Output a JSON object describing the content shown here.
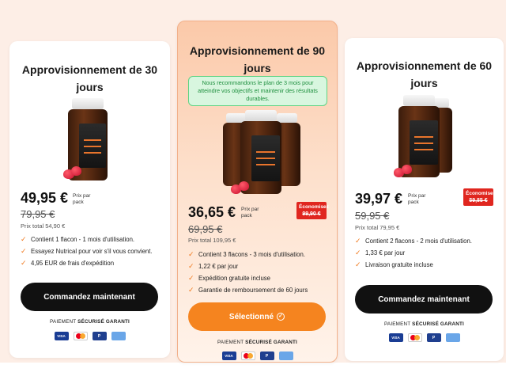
{
  "plans": [
    {
      "title": "Approvisionnement de 30 jours",
      "price": "49,95 €",
      "price_note": "Prix par pack",
      "old_price": "79,95 €",
      "total": "Prix total 54,90 €",
      "features": [
        "Contient 1 flacon - 1 mois d'utilisation.",
        "Essayez Nutrical pour voir s'il vous convient.",
        "4,95 EUR de frais d'expédition"
      ],
      "button": "Commandez maintenant"
    },
    {
      "title": "Approvisionnement de 90 jours",
      "recommendation": "Nous recommandons le plan de 3 mois pour atteindre vos objectifs et maintenir des résultats durables.",
      "price": "36,65 €",
      "price_note": "Prix par pack",
      "old_price": "69,95 €",
      "save_label": "Économisez",
      "save_amount": "99,90 €",
      "total": "Prix total 109,95 €",
      "features": [
        "Contient 3 flacons - 3 mois d'utilisation.",
        "1,22 € par jour",
        "Expédition gratuite incluse",
        "Garantie de remboursement de 60 jours"
      ],
      "button": "Sélectionné"
    },
    {
      "title": "Approvisionnement de 60 jours",
      "price": "39,97 €",
      "price_note": "Prix par pack",
      "old_price": "59,95 €",
      "save_label": "Économisez",
      "save_amount": "59,85 €",
      "total": "Prix total 79,95 €",
      "features": [
        "Contient 2 flacons - 2 mois d'utilisation.",
        "1,33 € par jour",
        "Livraison gratuite incluse"
      ],
      "button": "Commandez maintenant"
    }
  ],
  "secure": {
    "prefix": "PAIEMENT ",
    "bold": "SÉCURISÉ GARANTI"
  },
  "payment_methods": [
    "VISA",
    "mastercard",
    "PayPal",
    "AMEX"
  ],
  "colors": {
    "accent": "#f5841f",
    "check": "#f07a1f",
    "save_badge": "#e0261f",
    "recommend_bg": "#d8f6df"
  }
}
